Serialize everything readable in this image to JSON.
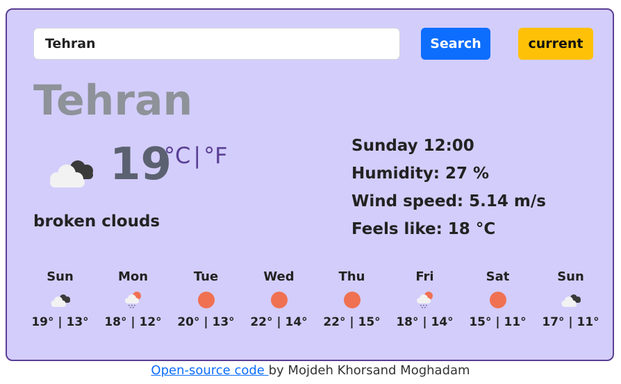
{
  "search": {
    "value": "Tehran",
    "button_label": "Search",
    "current_label": "current"
  },
  "current": {
    "city": "Tehran",
    "temperature": "19",
    "unit_c": "°C",
    "unit_sep": "|",
    "unit_f": "°F",
    "description": "broken clouds",
    "icon": "broken-clouds-icon",
    "day_time": "Sunday 12:00",
    "humidity": "Humidity: 27 %",
    "wind": "Wind speed: 5.14 m/s",
    "feels_like": "Feels like: 18 °C"
  },
  "forecast": [
    {
      "day": "Sun",
      "icon": "broken-clouds-icon",
      "temps": "19° | 13°"
    },
    {
      "day": "Mon",
      "icon": "rain-sun-icon",
      "temps": "18° | 12°"
    },
    {
      "day": "Tue",
      "icon": "sun-icon",
      "temps": "20° | 13°"
    },
    {
      "day": "Wed",
      "icon": "sun-icon",
      "temps": "22° | 14°"
    },
    {
      "day": "Thu",
      "icon": "sun-icon",
      "temps": "22° | 15°"
    },
    {
      "day": "Fri",
      "icon": "rain-sun-icon",
      "temps": "18° | 14°"
    },
    {
      "day": "Sat",
      "icon": "sun-icon",
      "temps": "15° | 11°"
    },
    {
      "day": "Sun",
      "icon": "broken-clouds-icon",
      "temps": "17° | 11°"
    }
  ],
  "footer": {
    "link_text": "Open-source code ",
    "suffix": "by Mojdeh Khorsand Moghadam"
  },
  "colors": {
    "card_bg": "#d3cdfb",
    "card_border": "#5a3f94",
    "search_button": "#0d6efd",
    "current_button": "#ffc107",
    "sun": "#ef7152"
  }
}
